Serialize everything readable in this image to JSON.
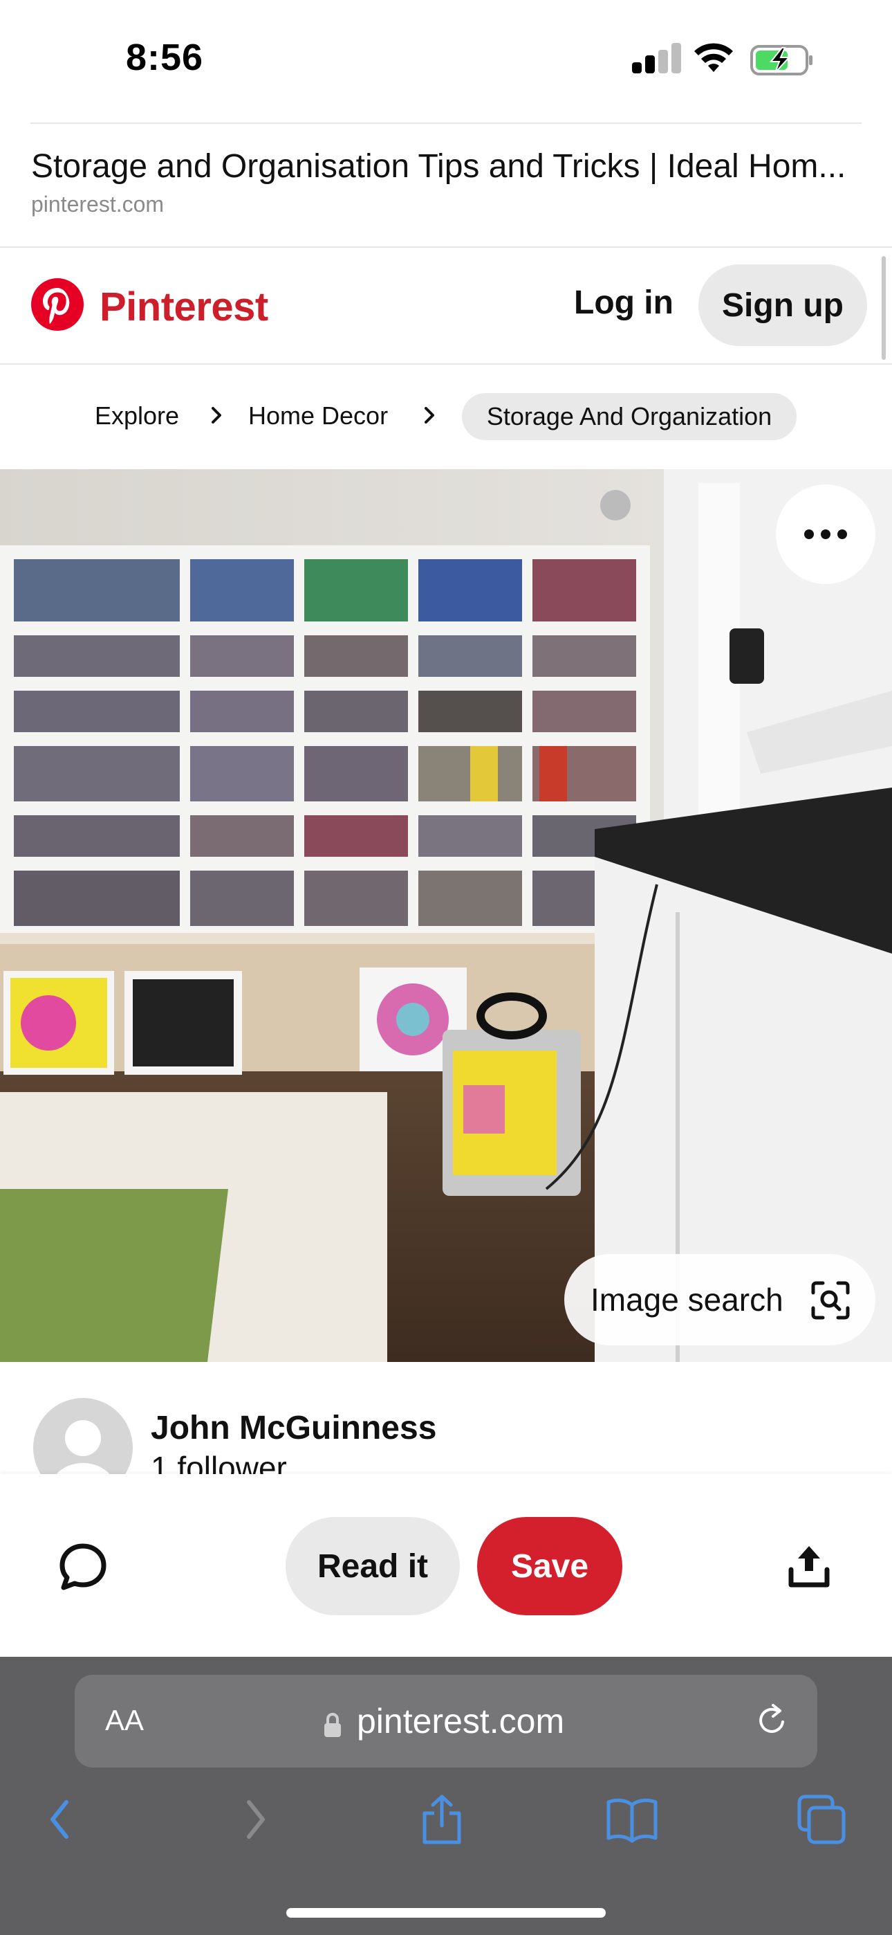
{
  "status_bar": {
    "time": "8:56",
    "signal_bars": 2,
    "battery_charging": true
  },
  "page_header": {
    "title": "Storage and Organisation Tips and Tricks | Ideal Hom...",
    "domain": "pinterest.com"
  },
  "nav": {
    "brand": "Pinterest",
    "login_label": "Log in",
    "signup_label": "Sign up"
  },
  "breadcrumbs": [
    "Explore",
    "Home Decor",
    "Storage And Organization"
  ],
  "pin": {
    "image_search_label": "Image search"
  },
  "author": {
    "name": "John McGuinness",
    "followers": "1 follower"
  },
  "actions": {
    "read_label": "Read it",
    "save_label": "Save"
  },
  "safari": {
    "aa_label": "AA",
    "url": "pinterest.com"
  },
  "colors": {
    "brand_red": "#e60023",
    "save_red": "#d41f2c",
    "safari_bar": "#5f5f61",
    "accent_blue": "#3b82f6"
  }
}
